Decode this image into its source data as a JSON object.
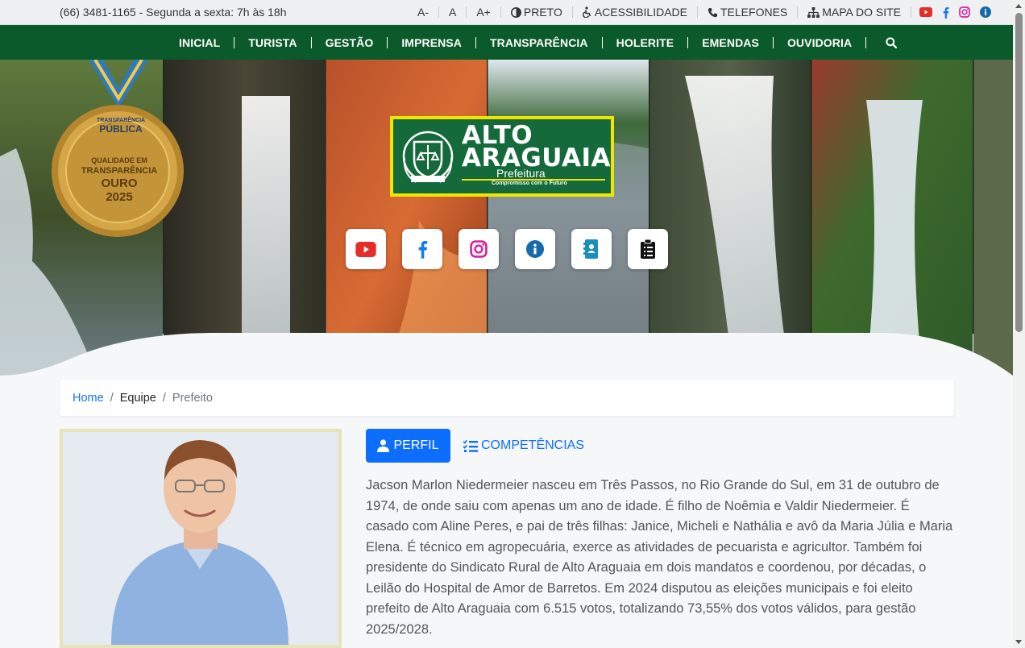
{
  "topbar": {
    "contact": "(66) 3481-1165 - Segunda a sexta: 7h às 18h",
    "font_decrease": "A-",
    "font_normal": "A",
    "font_increase": "A+",
    "contrast": "PRETO",
    "accessibility": "ACESSIBILIDADE",
    "phones": "TELEFONES",
    "sitemap": "MAPA DO SITE",
    "social_icons": [
      "youtube-icon",
      "facebook-icon",
      "instagram-icon",
      "info-icon"
    ]
  },
  "nav": {
    "items": [
      "INICIAL",
      "TURISTA",
      "GESTÃO",
      "IMPRENSA",
      "TRANSPARÊNCIA",
      "HOLERITE",
      "EMENDAS",
      "OUVIDORIA"
    ],
    "search_icon": "search-icon"
  },
  "hero": {
    "logo_title_line1": "ALTO",
    "logo_title_line2": "ARAGUAIA",
    "logo_subtitle": "Prefeitura",
    "logo_tagline": "Compromisso com o Futuro",
    "medal_line1": "TRANSPARÊNCIA",
    "medal_line2": "PÚBLICA",
    "medal_line3": "QUALIDADE EM",
    "medal_line4": "TRANSPARÊNCIA",
    "medal_line5": "OURO",
    "medal_line6": "2025",
    "icons": [
      "youtube-icon",
      "facebook-icon",
      "instagram-icon",
      "info-icon",
      "contacts-icon",
      "clipboard-icon"
    ],
    "colors": {
      "youtube": "#e52d27",
      "facebook": "#1877f2",
      "instagram": "#d6249f",
      "info": "#1769aa",
      "contacts": "#1a8fbf",
      "clipboard": "#111111"
    }
  },
  "breadcrumb": {
    "home": "Home",
    "separator": "/",
    "section": "Equipe",
    "current": "Prefeito"
  },
  "profile": {
    "tab_profile": "PERFIL",
    "tab_competencies": "COMPETÊNCIAS",
    "bio": "Jacson Marlon Niedermeier nasceu em Três Passos, no Rio Grande do Sul, em 31 de outubro de 1974, de onde saiu com apenas um ano de idade. É filho de Noêmia e Valdir Niedermeier. É casado com Aline Peres, e pai de três filhas: Janice, Micheli e Nathália e avô da Maria Júlia e Maria Elena. É técnico em agropecuária, exerce as atividades de pecuarista e agricultor. Também foi presidente do Sindicato Rural de Alto Araguaia em dois mandatos e coordenou, por décadas, o Leilão do Hospital de Amor de Barretos. Em 2024 disputou as eleições municipais e foi eleito prefeito de Alto Araguaia com 6.515 votos, totalizando 73,55% dos votos válidos, para gestão 2025/2028."
  },
  "theme": {
    "nav_green": "#0b5a2b",
    "link_blue": "#0d6efd",
    "logo_yellow": "#f2e600"
  }
}
